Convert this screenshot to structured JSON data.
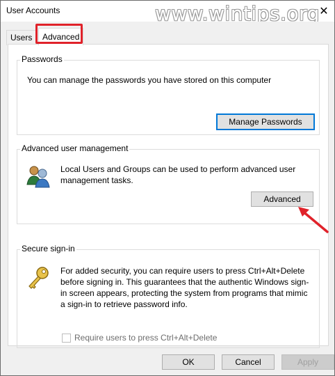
{
  "window": {
    "title": "User Accounts",
    "close_glyph": "✕",
    "watermark": "www.wintips.org"
  },
  "tabs": [
    {
      "label": "Users"
    },
    {
      "label": "Advanced",
      "selected": true
    }
  ],
  "passwords": {
    "title": "Passwords",
    "description": "You can manage the passwords you have stored on this computer",
    "button_label": "Manage Passwords"
  },
  "advanced_management": {
    "title": "Advanced user management",
    "description": "Local Users and Groups can be used to perform advanced user management tasks.",
    "button_label": "Advanced",
    "icon": "users-group-icon"
  },
  "secure_signin": {
    "title": "Secure sign-in",
    "description": "For added security, you can require users to press Ctrl+Alt+Delete before signing in. This guarantees that the authentic Windows sign-in screen appears, protecting the system from programs that mimic a sign-in to retrieve password info.",
    "checkbox_label": "Require users to press Ctrl+Alt+Delete",
    "checkbox_checked": false,
    "icon": "key-icon"
  },
  "footer": {
    "ok_label": "OK",
    "cancel_label": "Cancel",
    "apply_label": "Apply"
  },
  "colors": {
    "highlight_red": "#e0222a",
    "focus_blue": "#0078d7"
  }
}
